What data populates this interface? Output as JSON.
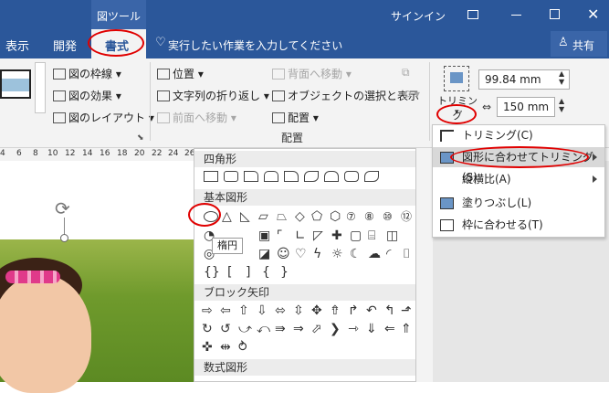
{
  "title_bar": {
    "context_tab": "図ツール",
    "signin": "サインイン",
    "window_controls": [
      "ribbon-display-icon",
      "minimize-icon",
      "maximize-icon",
      "close-icon"
    ]
  },
  "tabs": {
    "view": "表示",
    "developer": "開発",
    "format": "書式",
    "tell_me": "実行したい作業を入力してください",
    "share": "共有"
  },
  "ribbon": {
    "picture_border": "図の枠線",
    "picture_effects": "図の効果",
    "picture_layout": "図のレイアウト",
    "position": "位置",
    "wrap_text": "文字列の折り返し",
    "bring_forward": "前面へ移動",
    "send_backward": "背面へ移動",
    "selection_pane": "オブジェクトの選択と表示",
    "align": "配置",
    "group_arrange": "配置",
    "crop": "トリミング",
    "height": "99.84 mm",
    "width": "150 mm"
  },
  "ruler": [
    "4",
    "6",
    "8",
    "10",
    "12",
    "14",
    "16",
    "18",
    "20",
    "22",
    "24",
    "26",
    "28",
    "30",
    "32"
  ],
  "gallery": {
    "rect_header": "四角形",
    "basic_header": "基本図形",
    "block_arrow_header": "ブロック矢印",
    "equation_header": "数式図形",
    "tooltip": "楕円"
  },
  "crop_menu": {
    "items": [
      "トリミング(C)",
      "図形に合わせてトリミング(S)",
      "縦横比(A)",
      "塗りつぶし(L)",
      "枠に合わせる(T)"
    ]
  },
  "colors": {
    "accent": "#2b579a",
    "highlight": "#e00000"
  }
}
